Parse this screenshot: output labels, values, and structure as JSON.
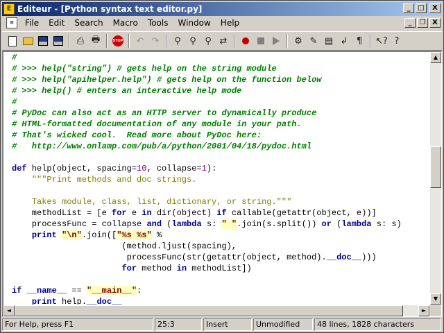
{
  "window": {
    "title": "Editeur - [Python syntax text editor.py]"
  },
  "title_controls": {
    "minimize": "_",
    "maximize": "□",
    "close": "X"
  },
  "menu": [
    "File",
    "Edit",
    "Search",
    "Macro",
    "Tools",
    "Window",
    "Help"
  ],
  "mdi_controls": {
    "minimize": "_",
    "restore": "❐",
    "close": "X"
  },
  "toolbar": {
    "icons": [
      "new-file-icon",
      "open-folder-icon",
      "save-all-icon",
      "save-icon",
      "print-preview-icon",
      "print-icon",
      "stop-icon",
      "undo-icon",
      "redo-icon",
      "find-icon",
      "find-next-icon",
      "find-prev-icon",
      "replace-icon",
      "record-macro-icon",
      "stop-macro-icon",
      "play-macro-icon",
      "options-icon",
      "syntax-icon",
      "window-list-icon",
      "word-wrap-icon",
      "show-whitespace-icon",
      "context-help-icon",
      "help-icon"
    ],
    "stop_label": "STOP"
  },
  "editor": {
    "lines": [
      [
        [
          "cm",
          "#"
        ]
      ],
      [
        [
          "cm",
          "# >>> help(\"string\") # gets help on the string module"
        ]
      ],
      [
        [
          "cm",
          "# >>> help(\"apihelper.help\") # gets help on the function below"
        ]
      ],
      [
        [
          "cm",
          "# >>> help() # enters an interactive help mode"
        ]
      ],
      [
        [
          "cm",
          "#"
        ]
      ],
      [
        [
          "cm",
          "# PyDoc can also act as an HTTP server to dynamically produce"
        ]
      ],
      [
        [
          "cm",
          "# HTML-formatted documentation of any module in your path."
        ]
      ],
      [
        [
          "cm",
          "# That's wicked cool.  Read more about PyDoc here:"
        ]
      ],
      [
        [
          "cm",
          "#   http://www.onlamp.com/pub/a/python/2001/04/18/pydoc.html"
        ]
      ],
      [
        [
          "",
          ""
        ]
      ],
      [
        [
          "kw",
          "def"
        ],
        [
          "",
          " help(object, spacing="
        ],
        [
          "nm",
          "10"
        ],
        [
          "",
          ", collapse="
        ],
        [
          "nm",
          "1"
        ],
        [
          "",
          "):"
        ]
      ],
      [
        [
          "",
          "    "
        ],
        [
          "st",
          "\"\"\"Print methods and doc strings."
        ]
      ],
      [
        [
          "",
          ""
        ]
      ],
      [
        [
          "",
          "    "
        ],
        [
          "st",
          "Takes module, class, list, dictionary, or string.\"\"\""
        ]
      ],
      [
        [
          "",
          "    methodList = [e "
        ],
        [
          "kw",
          "for"
        ],
        [
          "",
          " e "
        ],
        [
          "kw",
          "in"
        ],
        [
          "",
          " dir(object) "
        ],
        [
          "kw",
          "if"
        ],
        [
          "",
          " callable(getattr(object, e))]"
        ]
      ],
      [
        [
          "",
          "    processFunc = collapse "
        ],
        [
          "kw",
          "and"
        ],
        [
          "",
          " ("
        ],
        [
          "kw",
          "lambda"
        ],
        [
          "",
          " s: "
        ],
        [
          "hl",
          "\" \""
        ],
        [
          "",
          ".join(s.split()) "
        ],
        [
          "kw",
          "or"
        ],
        [
          "",
          " ("
        ],
        [
          "kw",
          "lambda"
        ],
        [
          "",
          " s: s)"
        ]
      ],
      [
        [
          "",
          "    "
        ],
        [
          "kw",
          "print"
        ],
        [
          "",
          " "
        ],
        [
          "hl",
          "\"\\n\""
        ],
        [
          "",
          ".join(["
        ],
        [
          "hl",
          "\"%s %s\""
        ],
        [
          "",
          " %"
        ]
      ],
      [
        [
          "",
          "                      (method.ljust(spacing),"
        ]
      ],
      [
        [
          "",
          "                       processFunc(str(getattr(object, method)."
        ],
        [
          "kw",
          "__doc__"
        ],
        [
          "",
          ")))"
        ]
      ],
      [
        [
          "",
          "                      "
        ],
        [
          "kw",
          "for"
        ],
        [
          "",
          " method "
        ],
        [
          "kw",
          "in"
        ],
        [
          "",
          " methodList])"
        ]
      ],
      [
        [
          "",
          ""
        ]
      ],
      [
        [
          "kw",
          "if"
        ],
        [
          "",
          " "
        ],
        [
          "kw",
          "__name__"
        ],
        [
          "",
          " == "
        ],
        [
          "hl",
          "\"__main__\""
        ],
        [
          "",
          ":"
        ]
      ],
      [
        [
          "",
          "    "
        ],
        [
          "kw",
          "print"
        ],
        [
          "",
          " help."
        ],
        [
          "kw",
          "__doc__"
        ]
      ]
    ]
  },
  "scroll": {
    "up": "▲",
    "down": "▼",
    "left": "◄",
    "right": "►"
  },
  "status": {
    "help": "For Help, press F1",
    "position": "25:3",
    "mode": "Insert",
    "modified": "Unmodified",
    "stats": "48 lines, 1828 characters"
  }
}
